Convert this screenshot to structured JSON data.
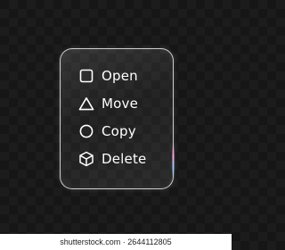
{
  "menu": {
    "items": [
      {
        "label": "Open",
        "icon": "square-icon"
      },
      {
        "label": "Move",
        "icon": "triangle-icon"
      },
      {
        "label": "Copy",
        "icon": "circle-icon"
      },
      {
        "label": "Delete",
        "icon": "cube-icon"
      }
    ]
  },
  "watermark": {
    "text": "shutterstock.com · 2644112805"
  },
  "colors": {
    "background": "#161616",
    "panel_border": "#ebebeb",
    "text": "#ffffff"
  }
}
